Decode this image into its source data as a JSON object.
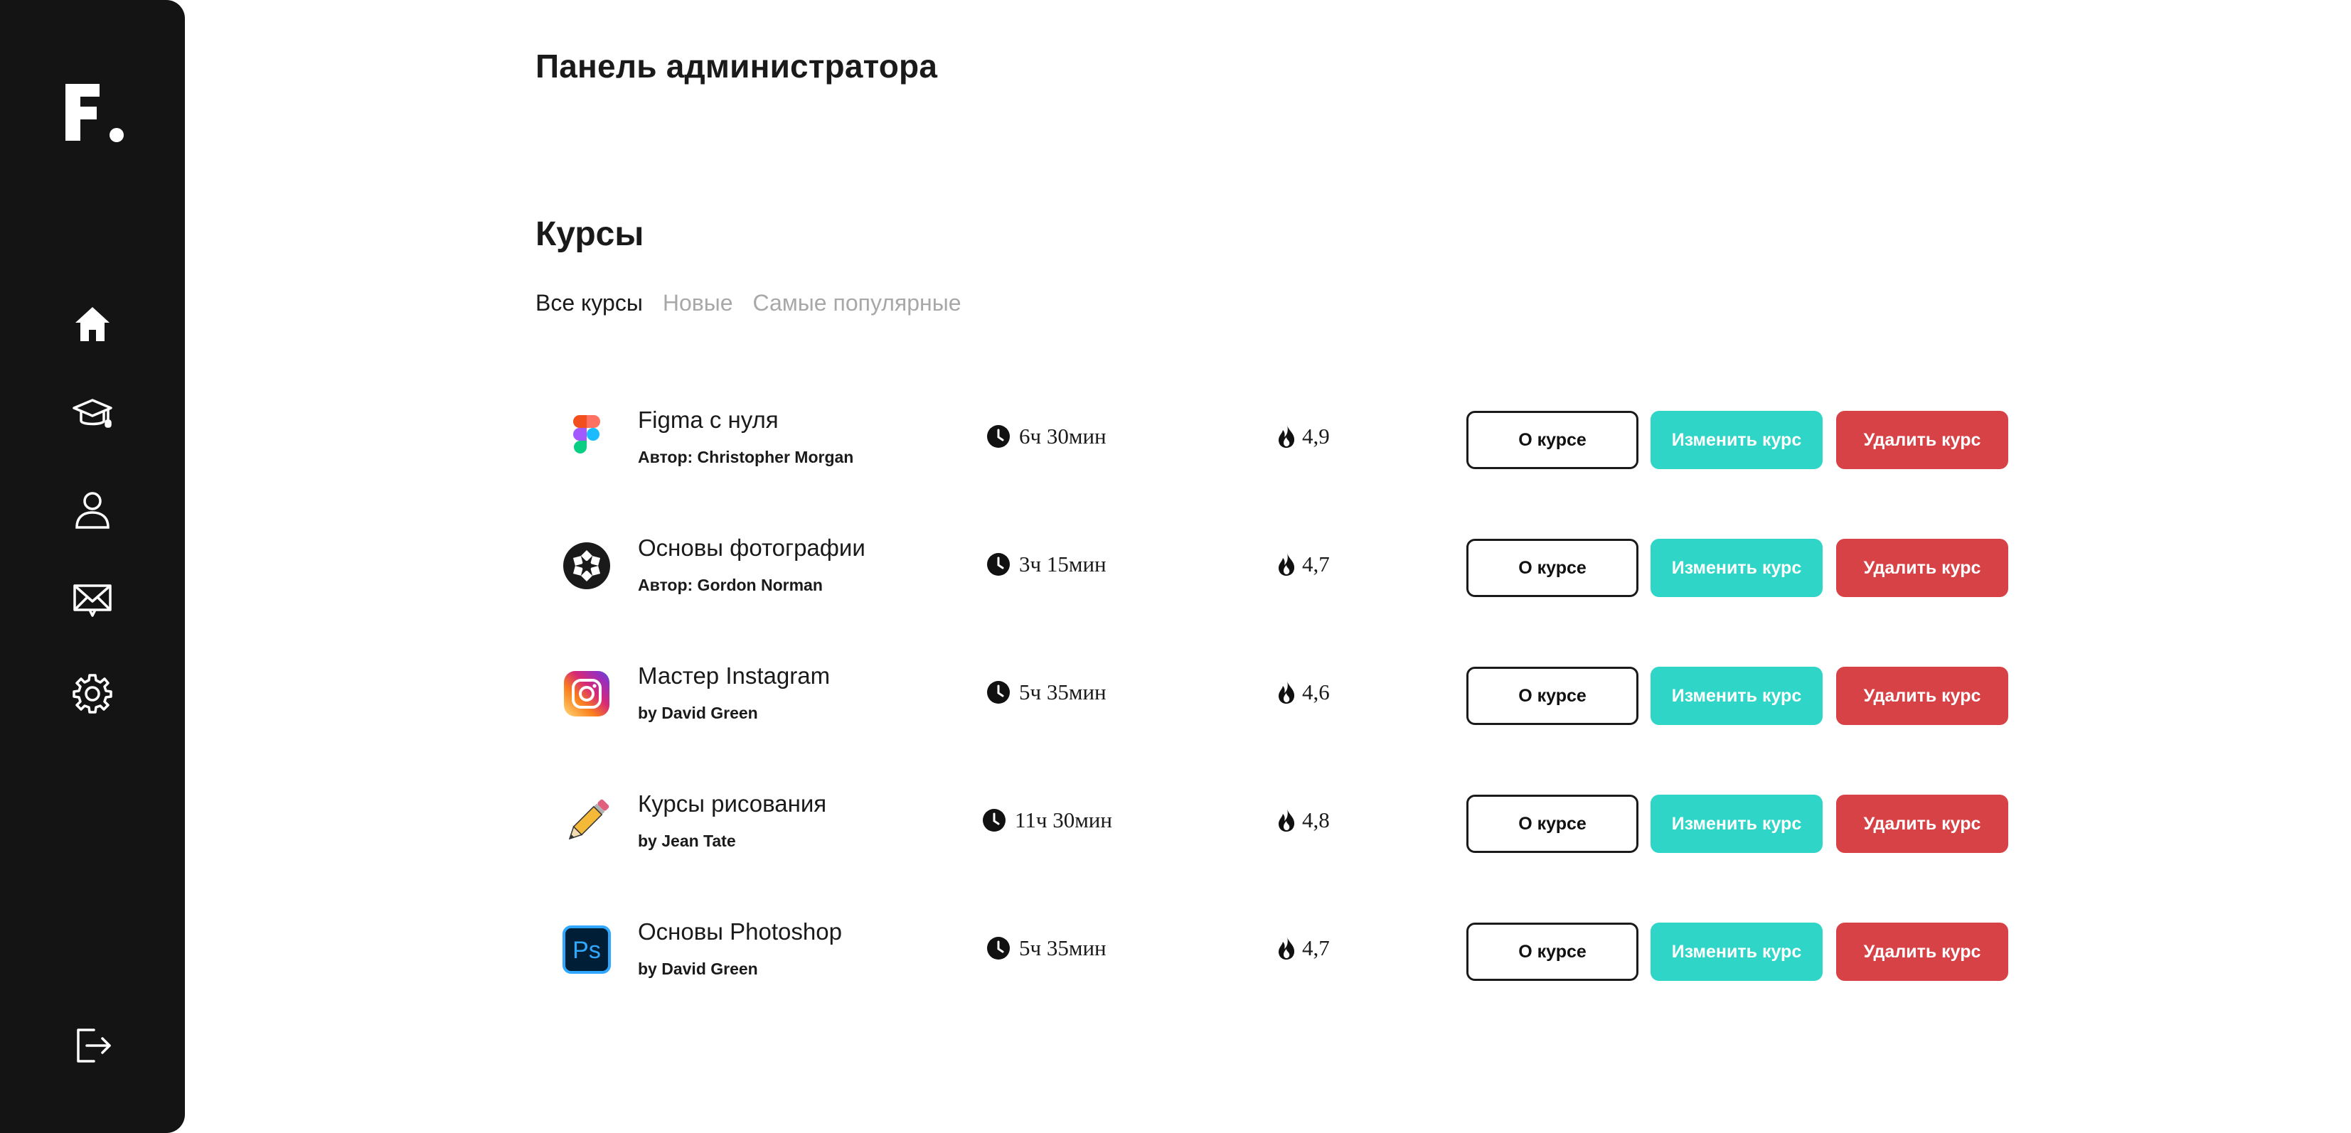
{
  "app": {
    "logo_text": "F."
  },
  "sidebar": {
    "items": [
      {
        "icon": "home-icon"
      },
      {
        "icon": "graduation-cap-icon"
      },
      {
        "icon": "user-icon"
      },
      {
        "icon": "mail-icon"
      },
      {
        "icon": "gear-icon"
      },
      {
        "icon": "logout-icon"
      }
    ]
  },
  "header": {
    "title": "Панель администратора"
  },
  "courses": {
    "title": "Курсы",
    "tabs": [
      {
        "label": "Все курсы",
        "active": true
      },
      {
        "label": "Новые",
        "active": false
      },
      {
        "label": "Самые популярные",
        "active": false
      }
    ],
    "buttons": {
      "about": "О курсе",
      "edit": "Изменить курс",
      "delete": "Удалить курс"
    },
    "items": [
      {
        "icon": "figma-icon",
        "title": "Figma с нуля",
        "author": "Автор: Christopher Morgan",
        "duration": "6ч 30мин",
        "rating": "4,9"
      },
      {
        "icon": "camera-aperture-icon",
        "title": "Основы фотографии",
        "author": "Автор: Gordon Norman",
        "duration": "3ч 15мин",
        "rating": "4,7"
      },
      {
        "icon": "instagram-icon",
        "title": "Мастер Instagram",
        "author": "by David Green",
        "duration": "5ч 35мин",
        "rating": "4,6"
      },
      {
        "icon": "pencil-icon",
        "title": "Курсы рисования",
        "author": "by Jean Tate",
        "duration": "11ч 30мин",
        "rating": "4,8"
      },
      {
        "icon": "photoshop-icon",
        "title": "Основы Photoshop",
        "author": "by David Green",
        "duration": "5ч 35мин",
        "rating": "4,7"
      }
    ]
  },
  "colors": {
    "sidebar": "#141414",
    "edit_button": "#2fd6c7",
    "delete_button": "#d74246",
    "inactive_tab": "#a8a8a8"
  }
}
